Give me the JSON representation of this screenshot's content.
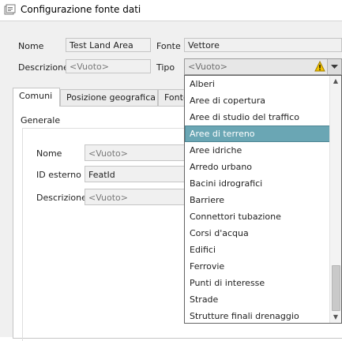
{
  "window": {
    "title": "Configurazione fonte dati"
  },
  "header": {
    "name_label": "Nome",
    "name_value": "Test Land Area",
    "source_label": "Fonte",
    "source_value": "Vettore",
    "description_label": "Descrizione",
    "description_value": "<Vuoto>",
    "type_label": "Tipo",
    "type_value": "<Vuoto>"
  },
  "tabs": [
    {
      "label": "Comuni"
    },
    {
      "label": "Posizione geografica"
    },
    {
      "label": "Fonte"
    }
  ],
  "general": {
    "section_label": "Generale",
    "name_label": "Nome",
    "name_value": "<Vuoto>",
    "external_id_label": "ID esterno",
    "external_id_value": "FeatId",
    "description_label": "Descrizione",
    "description_value": "<Vuoto>"
  },
  "dropdown": {
    "selected": "Aree di terreno",
    "options": [
      "Alberi",
      "Aree di copertura",
      "Aree di studio del traffico",
      "Aree di terreno",
      "Aree idriche",
      "Arredo urbano",
      "Bacini idrografici",
      "Barriere",
      "Connettori tubazione",
      "Corsi d'acqua",
      "Edifici",
      "Ferrovie",
      "Punti di interesse",
      "Strade",
      "Strutture finali drenaggio"
    ]
  },
  "colors": {
    "selection": "#6aa6b4",
    "warning": "#f2c200"
  },
  "icons": {
    "app": "app-icon",
    "warning": "warning-icon",
    "combo_arrow": "chevron-down-icon"
  }
}
